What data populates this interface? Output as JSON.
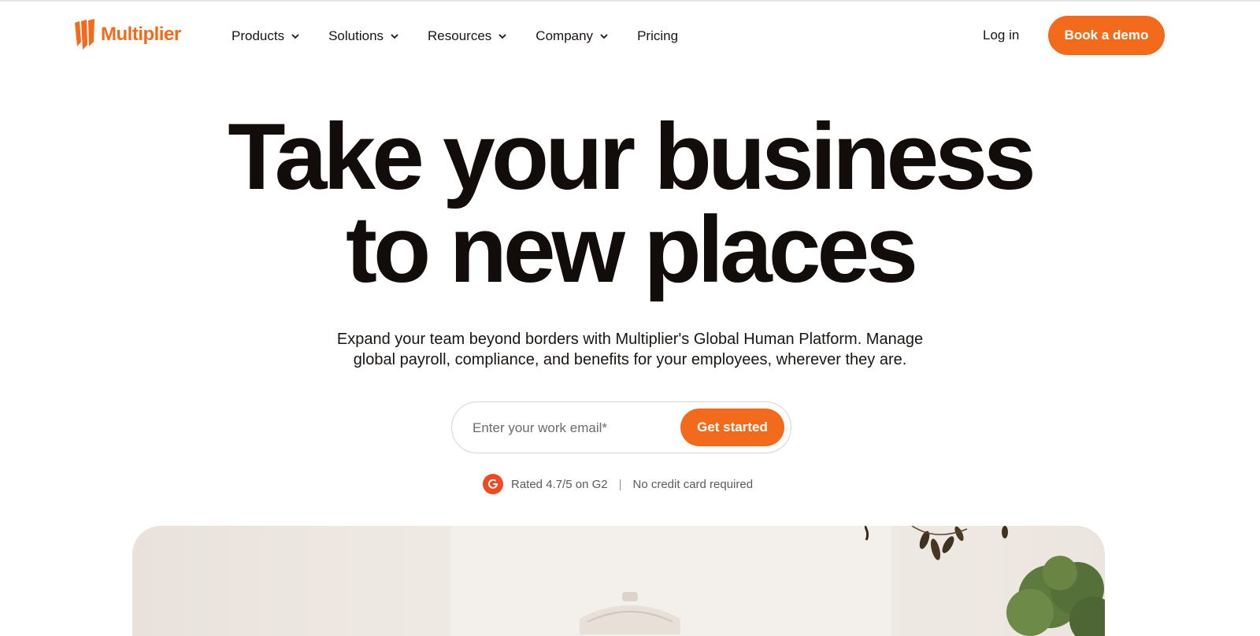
{
  "brand": {
    "name": "Multiplier",
    "color": "#f26b1d"
  },
  "nav": {
    "items": [
      {
        "label": "Products",
        "has_dropdown": true
      },
      {
        "label": "Solutions",
        "has_dropdown": true
      },
      {
        "label": "Resources",
        "has_dropdown": true
      },
      {
        "label": "Company",
        "has_dropdown": true
      },
      {
        "label": "Pricing",
        "has_dropdown": false
      }
    ],
    "login_label": "Log in",
    "demo_label": "Book a demo"
  },
  "hero": {
    "title_line1": "Take your business",
    "title_line2": "to new places",
    "subtitle_line1": "Expand your team beyond borders with Multiplier's Global Human Platform. Manage",
    "subtitle_line2": "global payroll, compliance, and benefits for your employees, wherever they are.",
    "email_placeholder": "Enter your work email*",
    "cta_label": "Get started",
    "rating_text": "Rated 4.7/5 on G2",
    "rating_separator": "|",
    "no_card_text": "No credit card required"
  },
  "icons": {
    "logo": "multiplier-logo-mark",
    "dropdown": "chevron-down-icon",
    "g2": "g2-badge-icon"
  }
}
